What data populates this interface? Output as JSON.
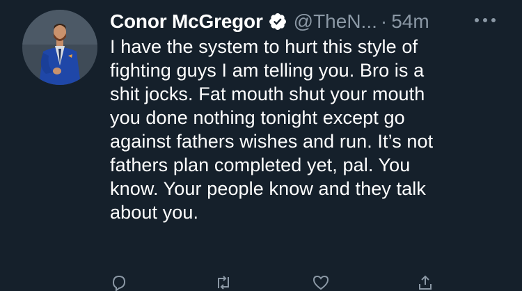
{
  "tweet": {
    "display_name": "Conor McGregor",
    "handle": "@TheN...",
    "separator": "·",
    "timestamp": "54m",
    "body": "I have the system to hurt this style of\nfighting guys I am telling you. Bro is a\nshit jocks. Fat mouth shut your mouth\nyou done nothing tonight except go\nagainst fathers wishes and run. It’s not\nfathers plan completed yet, pal. You\nknow.  Your people know and they talk\nabout you."
  },
  "icons": {
    "verified": "verified-badge-icon",
    "more": "more-options-icon",
    "reply": "reply-icon",
    "retweet": "retweet-icon",
    "like": "like-icon",
    "share": "share-icon"
  },
  "colors": {
    "background": "#15202b",
    "text": "#ffffff",
    "secondary_text": "#8b98a5",
    "verified": "#1d9bf0"
  }
}
